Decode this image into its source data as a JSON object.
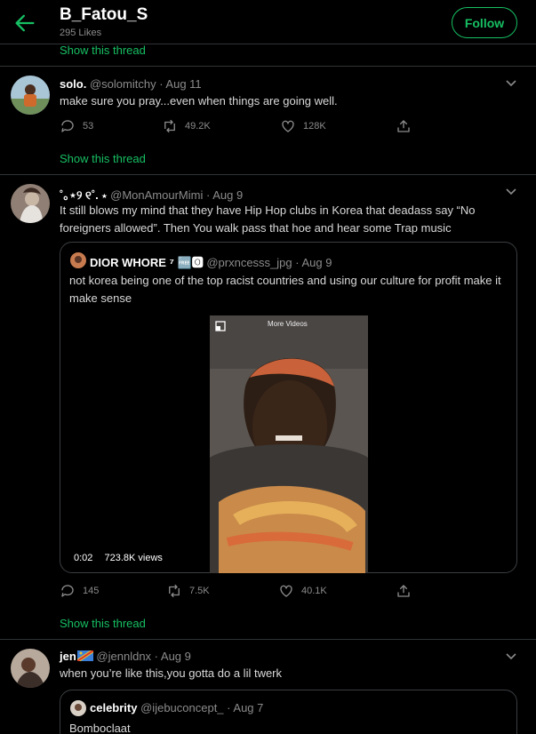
{
  "header": {
    "title": "B_Fatou_S",
    "subtitle": "295 Likes",
    "follow_label": "Follow"
  },
  "show_thread_label": "Show this thread",
  "tweets": [
    {
      "name": "solo.",
      "handle": "@solomitchy",
      "date": "· Aug 11",
      "text": "make sure you pray...even when things are going well.",
      "replies": "53",
      "retweets": "49.2K",
      "likes": "128K"
    },
    {
      "name": "˚｡⋆୨ ୧˚. ⋆",
      "handle": "@MonAmourMimi",
      "date": "· Aug 9",
      "text": "It still blows my mind that they have Hip Hop clubs in Korea that deadass say “No foreigners allowed”. Then You walk pass that hoe and hear some Trap music",
      "quote": {
        "name": "DIOR WHORE ⁷ 🆓🅾",
        "handle": "@prxncesss_jpg",
        "date": "· Aug 9",
        "text": "not korea being one of the top racist countries and using our culture for profit make it make sense",
        "video_overlay": "More Videos",
        "video_time": "0:02",
        "video_views": "723.8K views"
      },
      "replies": "145",
      "retweets": "7.5K",
      "likes": "40.1K"
    },
    {
      "name": "jen",
      "handle": "@jennldnx",
      "date": "· Aug 9",
      "text": "when you’re like this,you gotta do a lil twerk",
      "quote": {
        "name": "celebrity",
        "handle": "@ijebuconcept_",
        "date": "· Aug 7",
        "text": "Bomboclaat"
      }
    }
  ],
  "colors": {
    "accent": "#17bf63",
    "background": "#000000",
    "secondary_text": "#8b8b8b",
    "border": "#2f3336"
  }
}
